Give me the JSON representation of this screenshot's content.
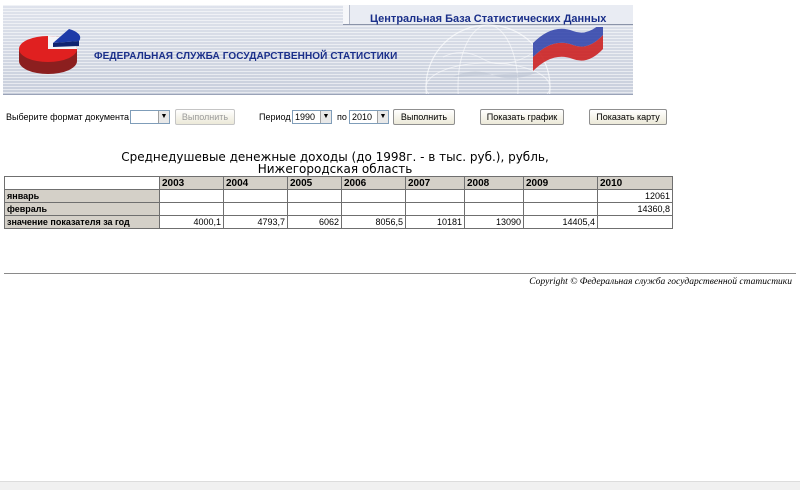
{
  "header": {
    "db_title": "Центральная База Статистических Данных",
    "org_title": "ФЕДЕРАЛЬНАЯ СЛУЖБА ГОСУДАРСТВЕННОЙ СТАТИСТИКИ",
    "accent_color": "#1a2f8a"
  },
  "controls": {
    "format_label": "Выберите формат документа",
    "format_value": "",
    "execute_disabled_label": "Выполнить",
    "period_label": "Период",
    "period_from": "1990",
    "period_to_label": "по",
    "period_to": "2010",
    "execute_label": "Выполнить",
    "show_chart_label": "Показать график",
    "show_map_label": "Показать карту"
  },
  "table": {
    "title_line1": "Среднедушевые денежные доходы (до 1998г. - в тыс. руб.), рубль,",
    "title_line2": "Нижегородская область",
    "years": [
      "2003",
      "2004",
      "2005",
      "2006",
      "2007",
      "2008",
      "2009",
      "2010"
    ],
    "rows": [
      {
        "label": "январь",
        "values": [
          "",
          "",
          "",
          "",
          "",
          "",
          "",
          "12061"
        ]
      },
      {
        "label": "февраль",
        "values": [
          "",
          "",
          "",
          "",
          "",
          "",
          "",
          "14360,8"
        ]
      },
      {
        "label": "значение показателя за год",
        "values": [
          "4000,1",
          "4793,7",
          "6062",
          "8056,5",
          "10181",
          "13090",
          "14405,4",
          ""
        ]
      }
    ]
  },
  "footer": {
    "copyright": "Copyright © Федеральная служба государственной статистики"
  }
}
